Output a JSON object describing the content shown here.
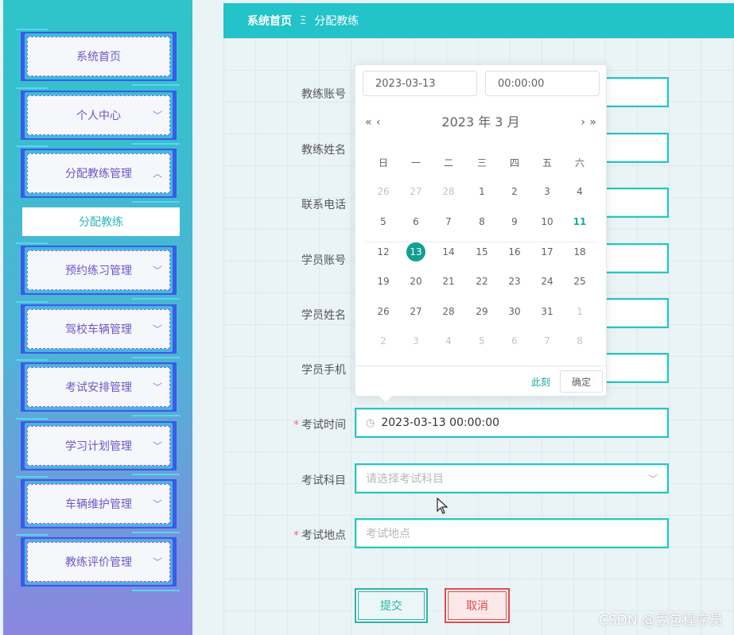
{
  "sidebar": {
    "items": [
      {
        "label": "系统首页",
        "has_arrow": false,
        "arrow": ""
      },
      {
        "label": "个人中心",
        "has_arrow": true,
        "arrow": "﹀"
      },
      {
        "label": "分配教练管理",
        "has_arrow": true,
        "arrow": "︿"
      },
      {
        "label": "预约练习管理",
        "has_arrow": true,
        "arrow": "﹀"
      },
      {
        "label": "驾校车辆管理",
        "has_arrow": true,
        "arrow": "﹀"
      },
      {
        "label": "考试安排管理",
        "has_arrow": true,
        "arrow": "﹀"
      },
      {
        "label": "学习计划管理",
        "has_arrow": true,
        "arrow": "﹀"
      },
      {
        "label": "车辆维护管理",
        "has_arrow": true,
        "arrow": "﹀"
      },
      {
        "label": "教练评价管理",
        "has_arrow": true,
        "arrow": "﹀"
      }
    ],
    "submenu_active": "分配教练"
  },
  "breadcrumb": {
    "home": "系统首页",
    "separator": "Ξ",
    "current": "分配教练"
  },
  "form": {
    "labels": {
      "coach_account": "教练账号",
      "coach_name": "教练姓名",
      "phone": "联系电话",
      "student_account": "学员账号",
      "student_name": "学员姓名",
      "student_phone": "学员手机",
      "exam_time": "考试时间",
      "exam_subject": "考试科目",
      "exam_location": "考试地点"
    },
    "required_mark": "*",
    "exam_time_value": "2023-03-13 00:00:00",
    "exam_subject_placeholder": "请选择考试科目",
    "exam_location_placeholder": "考试地点",
    "submit_label": "提交",
    "cancel_label": "取消"
  },
  "picker": {
    "date_input": "2023-03-13",
    "time_input": "00:00:00",
    "header": "2023 年  3 月",
    "prev_year": "«",
    "prev_month": "‹",
    "next_month": "›",
    "next_year": "»",
    "weekdays": [
      "日",
      "一",
      "二",
      "三",
      "四",
      "五",
      "六"
    ],
    "weeks": [
      [
        "26",
        "27",
        "28",
        "1",
        "2",
        "3",
        "4"
      ],
      [
        "5",
        "6",
        "7",
        "8",
        "9",
        "10",
        "11"
      ],
      [
        "12",
        "13",
        "14",
        "15",
        "16",
        "17",
        "18"
      ],
      [
        "19",
        "20",
        "21",
        "22",
        "23",
        "24",
        "25"
      ],
      [
        "26",
        "27",
        "28",
        "29",
        "30",
        "31",
        "1"
      ],
      [
        "2",
        "3",
        "4",
        "5",
        "6",
        "7",
        "8"
      ]
    ],
    "selected_day": "13",
    "today_day": "11",
    "now_label": "此刻",
    "confirm_label": "确定"
  },
  "watermark": "CSDN @豆包程序员",
  "colors": {
    "accent": "#22c3c9",
    "selected": "#12a08f",
    "danger": "#e04a4a"
  }
}
